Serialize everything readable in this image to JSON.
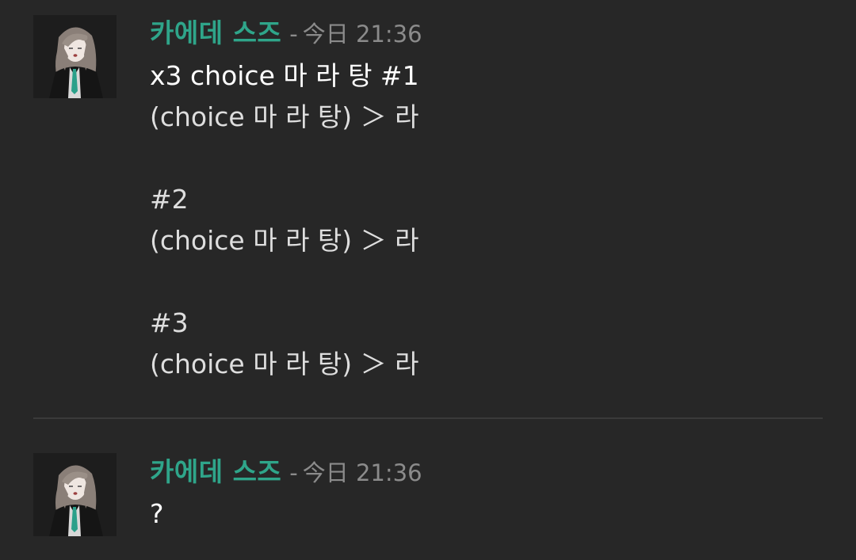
{
  "messages": [
    {
      "author": "카에데 스즈",
      "separator": "-",
      "timestamp": "今日 21:36",
      "lines": [
        "x3 choice 마 라 탕 #1",
        "(choice 마 라 탕) ＞ 라",
        "",
        "#2",
        "(choice 마 라 탕) ＞ 라",
        "",
        "#3",
        "(choice 마 라 탕) ＞ 라"
      ]
    },
    {
      "author": "카에데 스즈",
      "separator": "-",
      "timestamp": "今日 21:36",
      "lines": [
        "?"
      ]
    }
  ],
  "colors": {
    "background": "#272727",
    "author": "#2fa58a",
    "timestamp": "#8b8b8b",
    "text": "#dedede"
  },
  "icons": {
    "avatar": "anime-girl-avatar-icon"
  }
}
